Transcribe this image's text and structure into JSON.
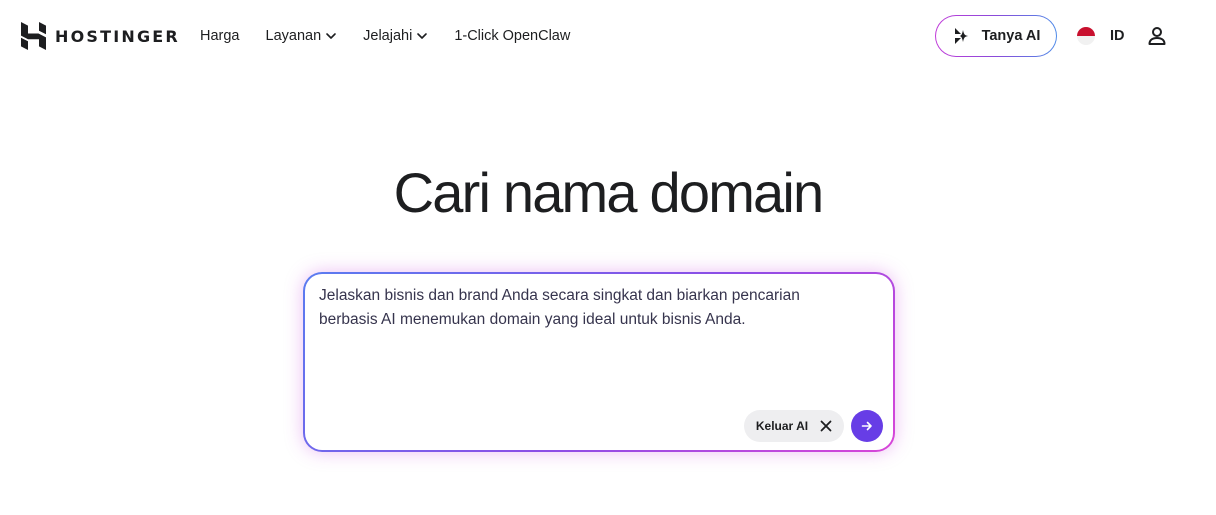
{
  "brand": {
    "name": "HOSTINGER",
    "logo_icon": "hostinger-logo-icon"
  },
  "nav": {
    "items": [
      {
        "label": "Harga",
        "dropdown": false
      },
      {
        "label": "Layanan",
        "dropdown": true
      },
      {
        "label": "Jelajahi",
        "dropdown": true
      },
      {
        "label": "1-Click OpenClaw",
        "dropdown": false
      }
    ]
  },
  "header_actions": {
    "ask_ai_label": "Tanya AI",
    "ask_ai_icon": "ai-sparkle-icon",
    "language_label": "ID",
    "language_flag": "indonesia-flag-icon",
    "account_icon": "user-icon"
  },
  "hero": {
    "title": "Cari nama domain"
  },
  "search": {
    "value": "",
    "placeholder": "Jelaskan bisnis dan brand Anda secara singkat dan biarkan pencarian berbasis AI menemukan domain yang ideal untuk bisnis Anda.",
    "exit_ai_label": "Keluar AI",
    "exit_icon": "close-icon",
    "submit_icon": "arrow-right-icon"
  },
  "colors": {
    "primary": "#673de6",
    "text": "#1d1e20",
    "flag_red": "#c8102e",
    "gradient_start": "#5a7cf0",
    "gradient_end": "#d845d8"
  }
}
